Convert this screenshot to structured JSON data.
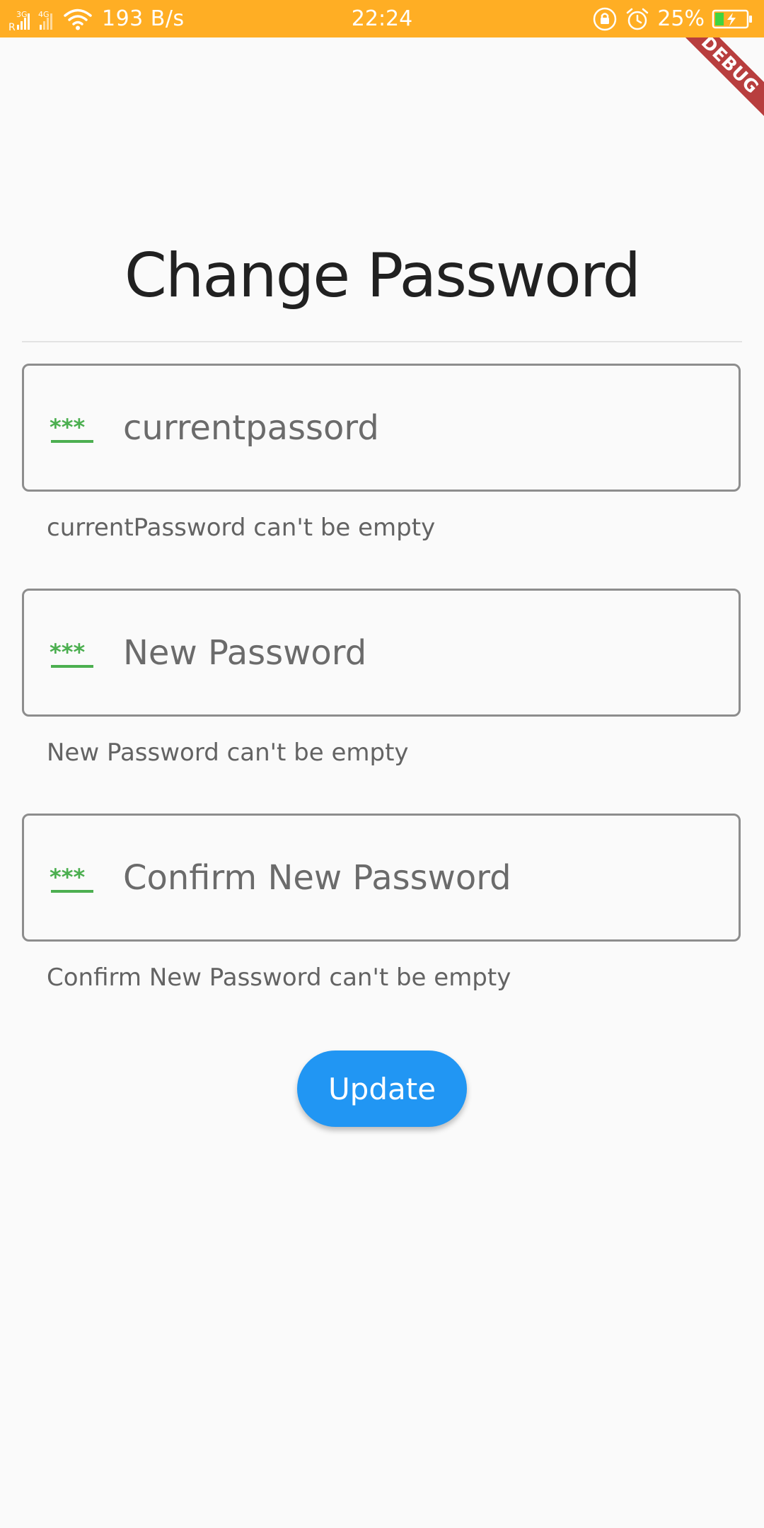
{
  "status_bar": {
    "network_left": "R",
    "network_type_1": "3G",
    "network_type_2": "4G",
    "net_speed": "193 B/s",
    "time": "22:24",
    "battery_percent": "25%",
    "bar_color": "#ffae24",
    "icons": [
      "signal-icon",
      "wifi-icon",
      "lock-rotation-icon",
      "alarm-icon",
      "battery-charging-icon"
    ]
  },
  "debug_banner": {
    "label": "DEBUG",
    "color": "#b83e3e"
  },
  "page": {
    "title": "Change Password"
  },
  "form": {
    "fields": [
      {
        "icon": "password-icon",
        "placeholder": "currentpassord",
        "value": "",
        "error": "currentPassword can't be empty"
      },
      {
        "icon": "password-icon",
        "placeholder": "New Password",
        "value": "",
        "error": "New Password can't be empty"
      },
      {
        "icon": "password-icon",
        "placeholder": "Confirm New Password",
        "value": "",
        "error": "Confirm New Password can't be empty"
      }
    ],
    "icon_color": "#4caf50",
    "submit_label": "Update",
    "submit_color": "#2196f3"
  }
}
